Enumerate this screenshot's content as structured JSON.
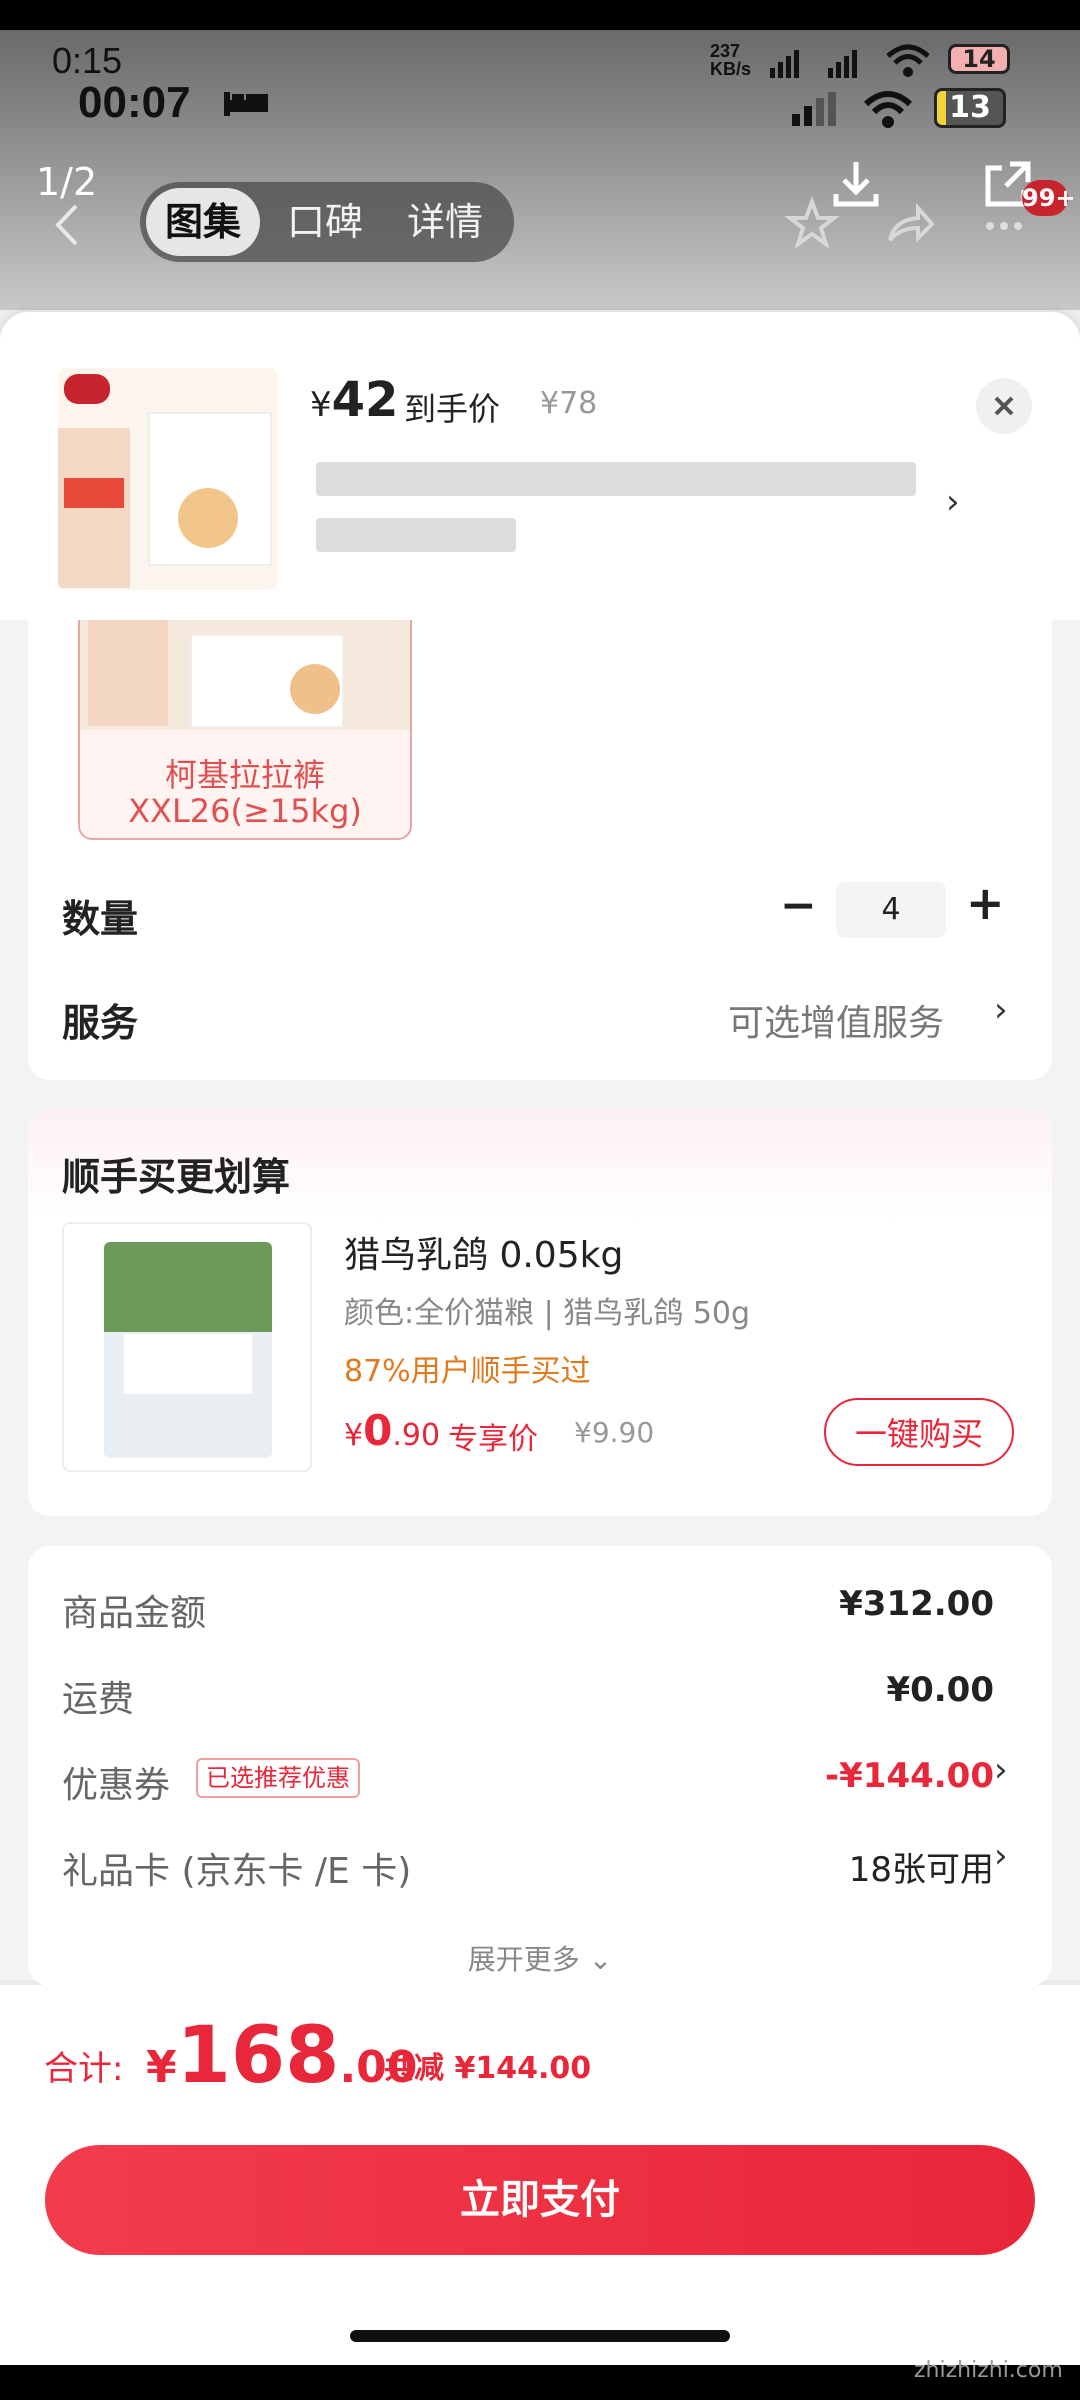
{
  "status": {
    "time_top": "0:15",
    "time_main": "00:07",
    "speed": "237",
    "speed_unit": "KB/s",
    "battery_top": "14",
    "battery_main": "13"
  },
  "gallery": {
    "counter": "1/2",
    "tabs": [
      "图集",
      "口碑",
      "详情"
    ],
    "badge": "99+"
  },
  "promo": {
    "price_symbol": "¥",
    "price": "42",
    "price_label": "到手价",
    "original_price": "¥78"
  },
  "sku": {
    "name_line1": "柯基拉拉裤",
    "name_line2": "XXL26(≥15kg)"
  },
  "quantity": {
    "label": "数量",
    "minus": "−",
    "value": "4",
    "plus": "+"
  },
  "service": {
    "label": "服务",
    "value": "可选增值服务"
  },
  "addon": {
    "section_title": "顺手买更划算",
    "product_name": "猎鸟乳鸽 0.05kg",
    "spec": "颜色:全价猫粮 | 猎鸟乳鸽 50g",
    "social": "87%用户顺手买过",
    "price_symbol": "¥",
    "price_int": "0",
    "price_dec": ".90",
    "price_tag": "专享价",
    "original_price": "¥9.90",
    "buy_button": "一键购买"
  },
  "summary": {
    "goods_label": "商品金额",
    "goods_value": "¥312.00",
    "shipping_label": "运费",
    "shipping_value": "¥0.00",
    "coupon_label": "优惠券",
    "coupon_tag": "已选推荐优惠",
    "coupon_value": "-¥144.00",
    "giftcard_label": "礼品卡 (京东卡 /E 卡)",
    "giftcard_value": "18张可用",
    "expand": "展开更多"
  },
  "footer": {
    "total_label": "合计:",
    "total_symbol": "¥",
    "total_int": "168",
    "total_dec": ".00",
    "discount": "共减 ¥144.00",
    "pay_button": "立即支付"
  },
  "watermark": "zhizhizhi.com",
  "colors": {
    "accent_red": "#e8283a",
    "coupon_orange": "#e07a1f"
  }
}
